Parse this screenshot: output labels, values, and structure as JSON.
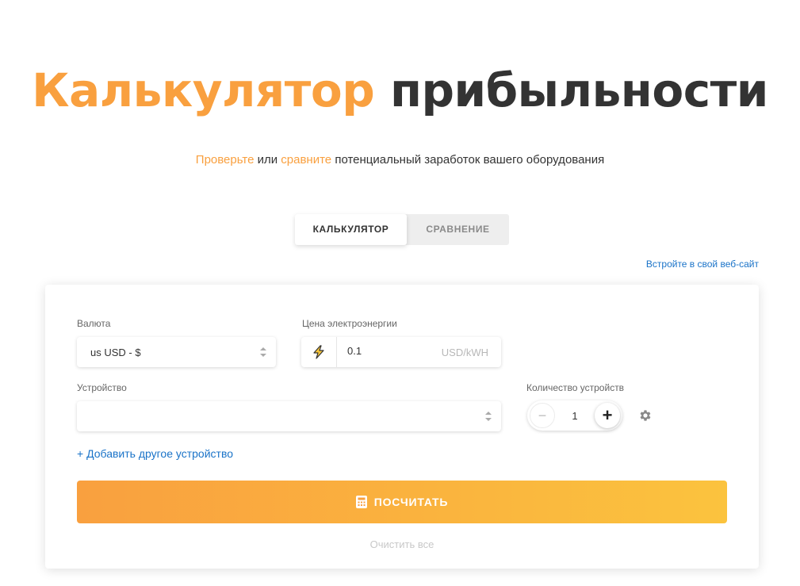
{
  "header": {
    "title_accent": "Калькулятор",
    "title_rest": "прибыльности",
    "subtitle_check": "Проверьте",
    "subtitle_or": "или",
    "subtitle_compare": "сравните",
    "subtitle_rest": "потенциальный заработок вашего оборудования"
  },
  "tabs": [
    {
      "label": "КАЛЬКУЛЯТОР",
      "active": true
    },
    {
      "label": "СРАВНЕНИЕ",
      "active": false
    }
  ],
  "embed_link": "Встройте в свой веб-сайт",
  "form": {
    "currency": {
      "label": "Валюта",
      "value": "us USD - $"
    },
    "electricity": {
      "label": "Цена электроэнергии",
      "value": "0.1",
      "unit": "USD/kWH"
    },
    "device": {
      "label": "Устройство",
      "value": ""
    },
    "device_count": {
      "label": "Количество устройств",
      "value": "1",
      "minus": "−",
      "plus": "+"
    },
    "add_device": "+ Добавить другое устройство",
    "calculate": "ПОСЧИТАТЬ",
    "clear_all": "Очистить все"
  },
  "colors": {
    "accent": "#f9a03f",
    "link": "#1a73c8",
    "button_gradient_end": "#fbc33e"
  },
  "icons": [
    "lightning-icon",
    "gear-icon",
    "calculator-icon",
    "select-arrows-icon"
  ]
}
